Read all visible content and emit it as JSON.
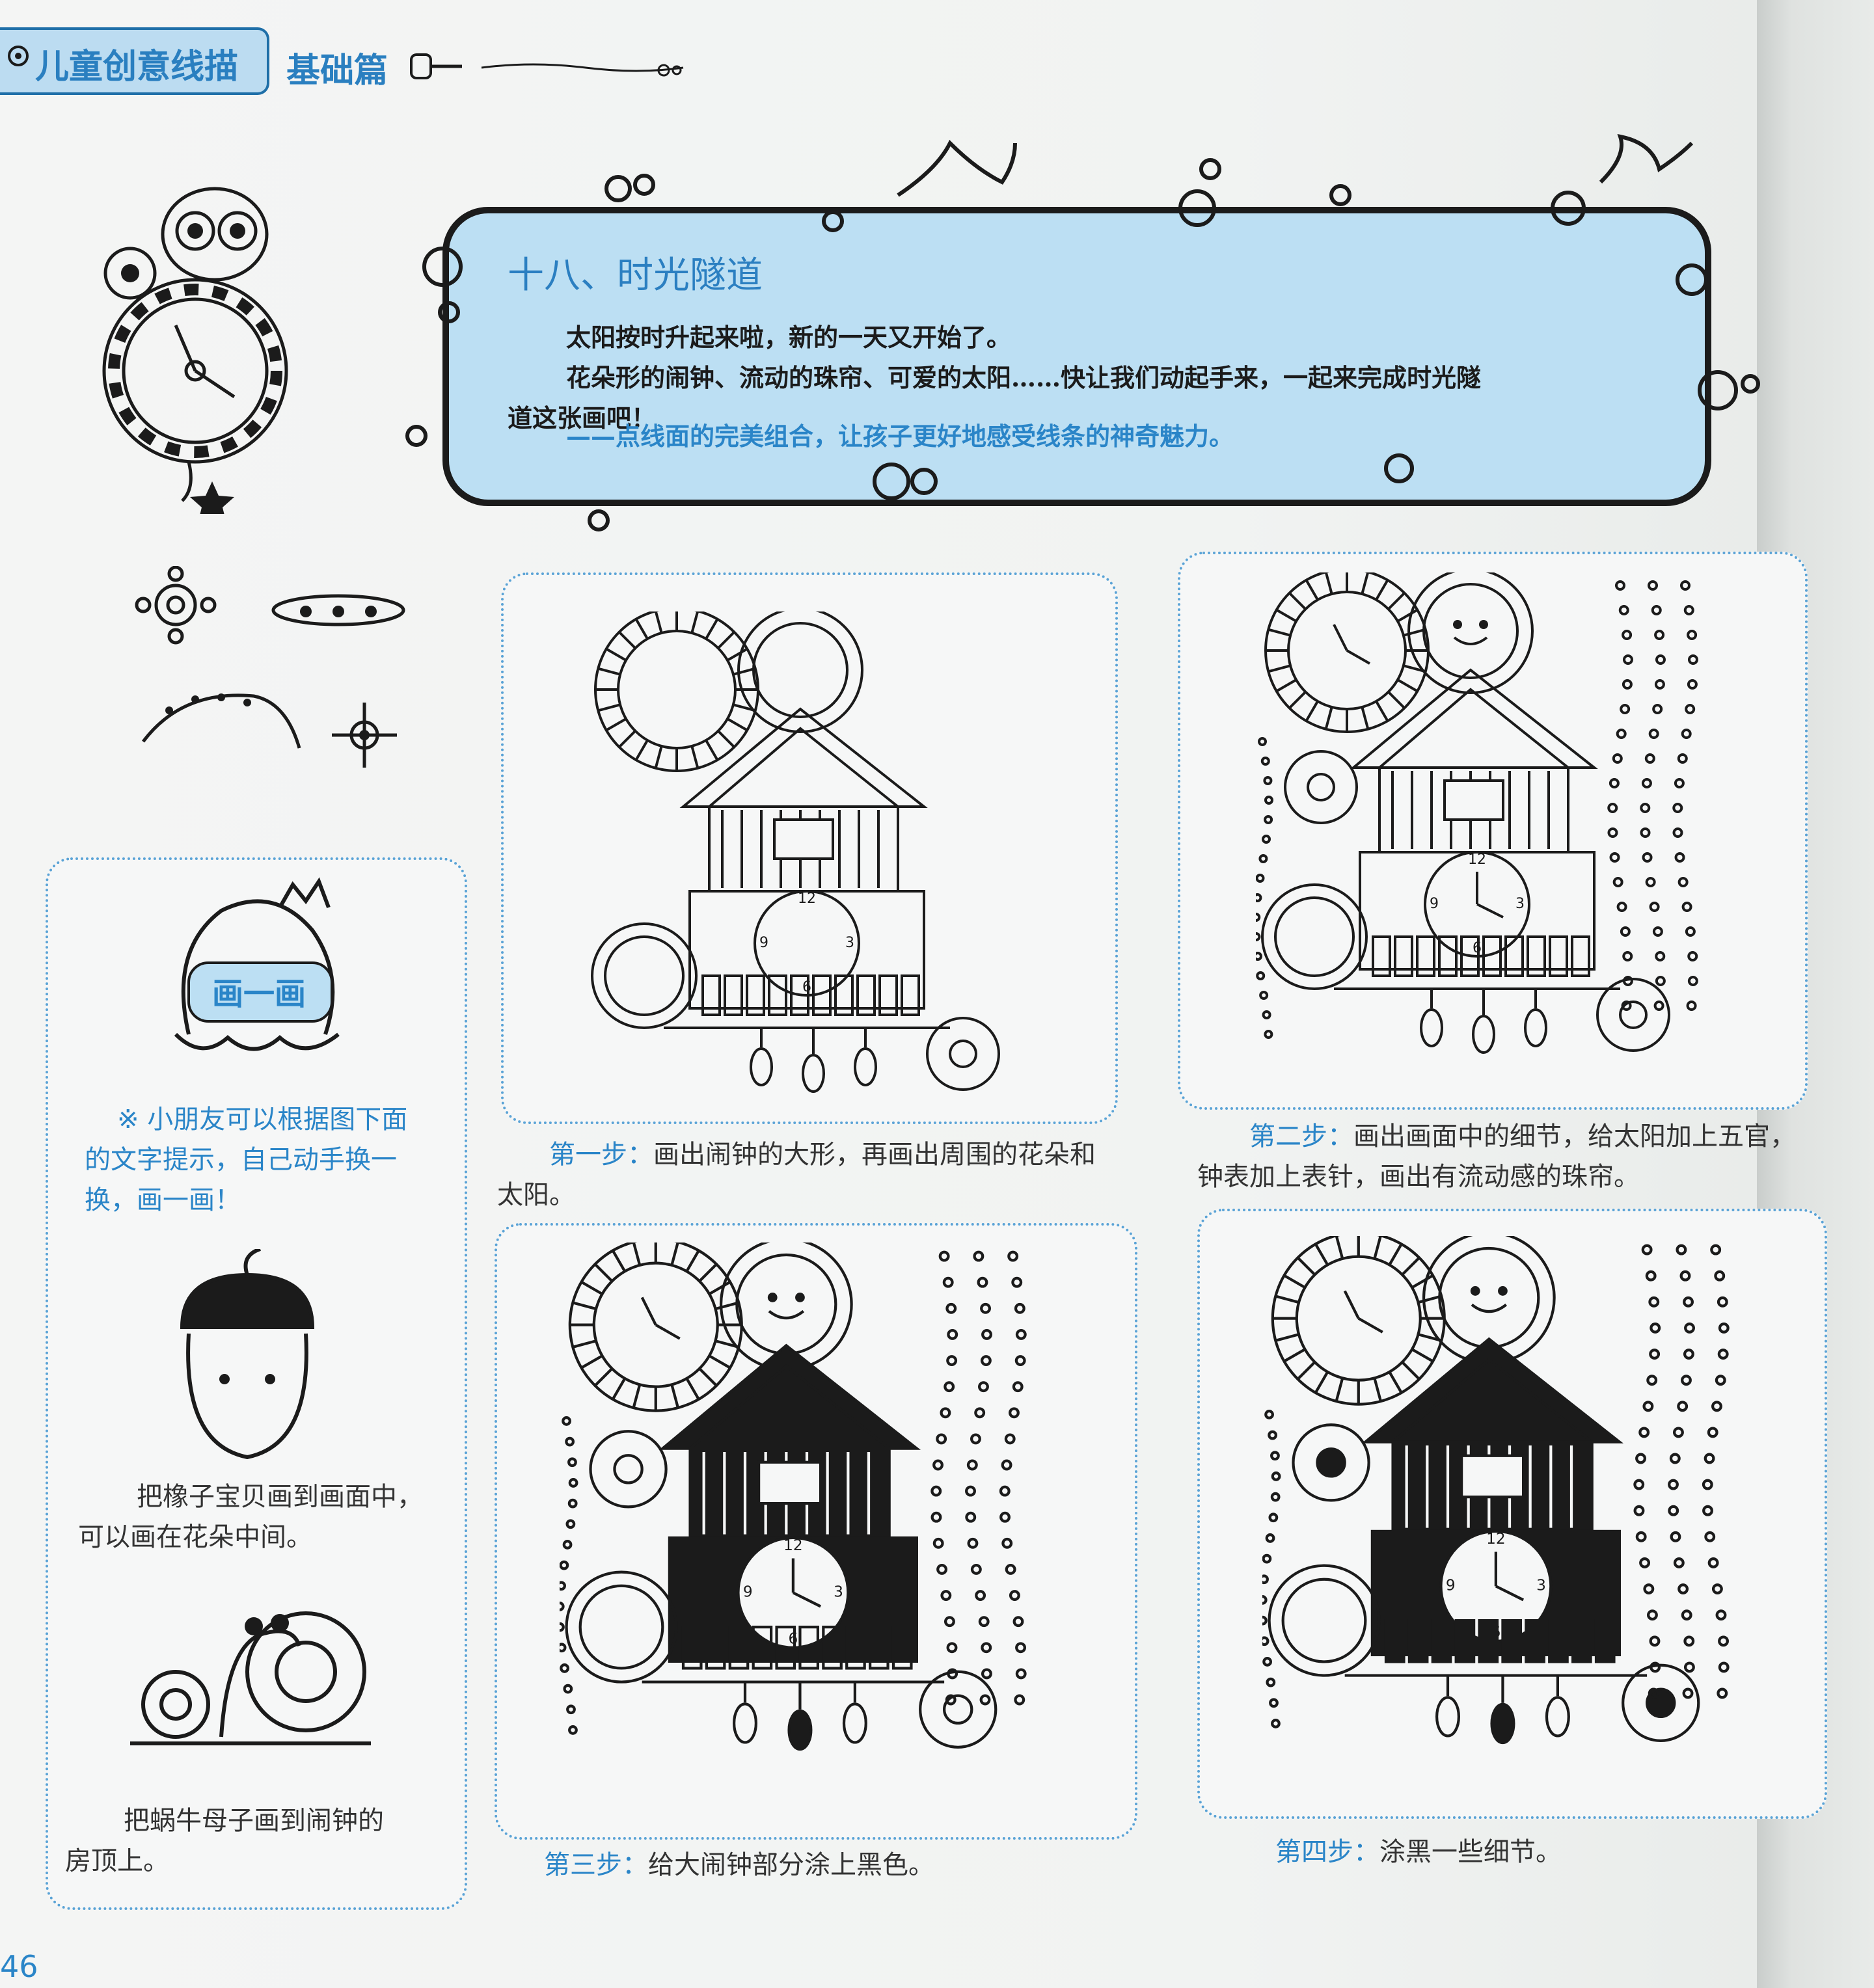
{
  "header": {
    "book_title": "儿童创意线描",
    "section": "基础篇"
  },
  "intro": {
    "title": "十八、时光隧道",
    "line1": "太阳按时升起来啦，新的一天又开始了。",
    "line2": "花朵形的闹钟、流动的珠帘、可爱的太阳……快让我们动起手来，一起来完成时光隧",
    "line3": "道这张画吧！",
    "line4": "——点线面的完美组合，让孩子更好地感受线条的神奇魅力。"
  },
  "sidebar": {
    "badge": "画一画",
    "tip_line1": "※ 小朋友可以根据图下面",
    "tip_line2": "的文字提示，自己动手换一",
    "tip_line3": "换，画一画！",
    "acorn_line1": "把橡子宝贝画到画面中，",
    "acorn_line2": "可以画在花朵中间。",
    "snail_line1": "把蜗牛母子画到闹钟的",
    "snail_line2": "房顶上。"
  },
  "steps": [
    {
      "label": "第一步：",
      "line1": "画出闹钟的大形，再画出周围的花朵和",
      "line2": "太阳。"
    },
    {
      "label": "第二步：",
      "line1": "画出画面中的细节，给太阳加上五官，",
      "line2": "钟表加上表针，画出有流动感的珠帘。"
    },
    {
      "label": "第三步：",
      "line1": "给大闹钟部分涂上黑色。",
      "line2": ""
    },
    {
      "label": "第四步：",
      "line1": "涂黑一些细节。",
      "line2": ""
    }
  ],
  "clock_numbers": [
    "12",
    "9",
    "3",
    "6"
  ],
  "page_number": "46",
  "colors": {
    "accent_blue": "#2a85c8",
    "bubble_fill": "#bcdff3",
    "panel_border": "#5aa3d6"
  }
}
